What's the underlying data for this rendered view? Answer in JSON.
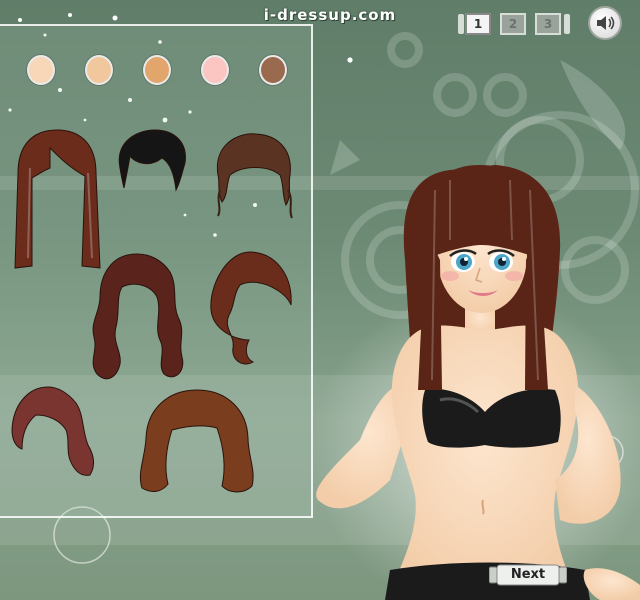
{
  "site": {
    "logo_text": "i-dressup.com"
  },
  "steps": [
    {
      "label": "1",
      "active": true
    },
    {
      "label": "2",
      "active": false
    },
    {
      "label": "3",
      "active": false
    }
  ],
  "sound": {
    "icon": "speaker-icon",
    "state": "on"
  },
  "skin_tones": [
    "#f7d7b8",
    "#f1c79d",
    "#e2a56c",
    "#fbc5c2",
    "#9a6a4e"
  ],
  "hairstyles": [
    {
      "name": "hair-long-straight-bangs",
      "color": "#6b2c1c"
    },
    {
      "name": "hair-short-black",
      "color": "#151515"
    },
    {
      "name": "hair-updo-curly",
      "color": "#5a3322"
    },
    {
      "name": "hair-long-wavy",
      "color": "#5a241c"
    },
    {
      "name": "hair-side-swept-wavy",
      "color": "#6a2c1b"
    },
    {
      "name": "hair-short-side",
      "color": "#7a3530"
    },
    {
      "name": "hair-medium-layered",
      "color": "#7a3d1e"
    }
  ],
  "buttons": {
    "next_label": "Next"
  },
  "colors": {
    "background": "#6c8a74",
    "panel_border": "#ffffff",
    "skin": "#f9dcc0",
    "top": "#1b1b1b"
  }
}
